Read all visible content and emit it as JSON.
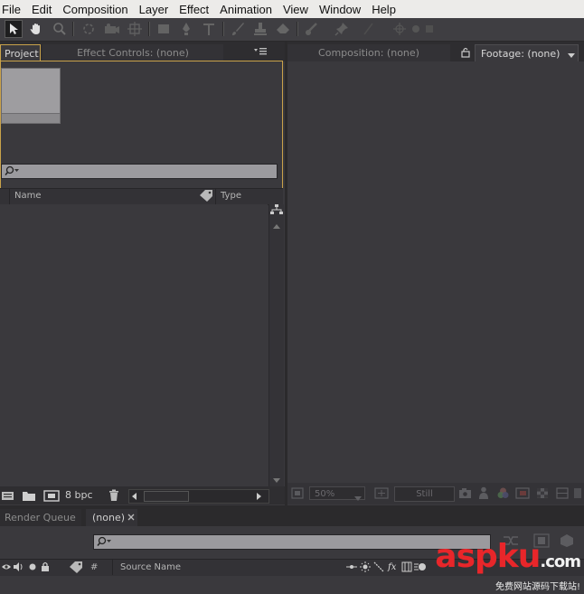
{
  "menubar": {
    "items": [
      "File",
      "Edit",
      "Composition",
      "Layer",
      "Effect",
      "Animation",
      "View",
      "Window",
      "Help"
    ]
  },
  "toolbar": {
    "tools": [
      "selection-tool",
      "hand-tool",
      "zoom-tool",
      "rotation-tool",
      "camera-tool",
      "pan-behind-tool",
      "rectangle-tool",
      "pen-tool",
      "type-tool",
      "brush-tool",
      "clone-stamp-tool",
      "eraser-tool",
      "roto-brush-tool",
      "puppet-pin-tool"
    ]
  },
  "project_panel": {
    "tab_project": "Project",
    "tab_effect_controls": "Effect Controls: (none)",
    "columns": {
      "name": "Name",
      "type": "Type"
    },
    "bit_depth": "8 bpc"
  },
  "viewer_panel": {
    "tab_composition": "Composition: (none)",
    "tab_footage": "Footage: (none)",
    "zoom": "50%",
    "still": "Still"
  },
  "bottom_panel": {
    "tab_render_queue": "Render Queue",
    "tab_none": "(none)",
    "layer_columns": {
      "number": "#",
      "source_name": "Source Name"
    }
  },
  "watermark": {
    "brand": "aspku",
    "domain": ".com",
    "tagline": "免费网站源码下载站!"
  },
  "colors": {
    "panel_bg": "#3a393d",
    "menubar_bg": "#ecebe9",
    "highlight_border": "#c9a24a",
    "watermark_red": "#e8262a"
  }
}
